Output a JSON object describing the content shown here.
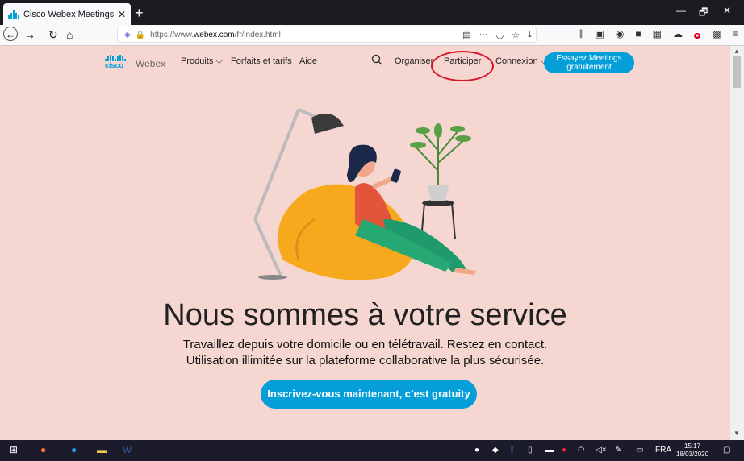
{
  "browser": {
    "tab_title": "Cisco Webex Meetings | Vidéo",
    "tab_close": "✕",
    "new_tab": "+",
    "window_min": "—",
    "window_restore": "🗗",
    "window_close": "✕",
    "url_prefix": "https://www.",
    "url_domain": "webex.com",
    "url_path": "/fr/index.html",
    "toolbar_more": "···"
  },
  "site": {
    "logo_top": "cisco",
    "logo_product": "Webex",
    "nav": {
      "produits": "Produits ⌵",
      "forfaits": "Forfaits et tarifs",
      "aide": "Aide",
      "organiser": "Organiser",
      "participer": "Participer",
      "connexion": "Connexion ⌵"
    },
    "cta_line1": "Essayez Meetings",
    "cta_line2": "gratuitement",
    "headline": "Nous sommes à votre service",
    "subline1": "Travaillez depuis votre domicile ou en télétravail. Restez en contact.",
    "subline2": "Utilisation illimitée sur la plateforme collaborative la plus sécurisée.",
    "signup_button": "Inscrivez-vous maintenant, c’est gratuity"
  },
  "taskbar": {
    "language": "FRA",
    "time": "15:17",
    "date": "18/03/2020"
  },
  "colors": {
    "page_background": "#f6d6d1",
    "accent_blue": "#049fd9",
    "annotation_red": "#d8142a",
    "taskbar": "#1b1b2b"
  }
}
